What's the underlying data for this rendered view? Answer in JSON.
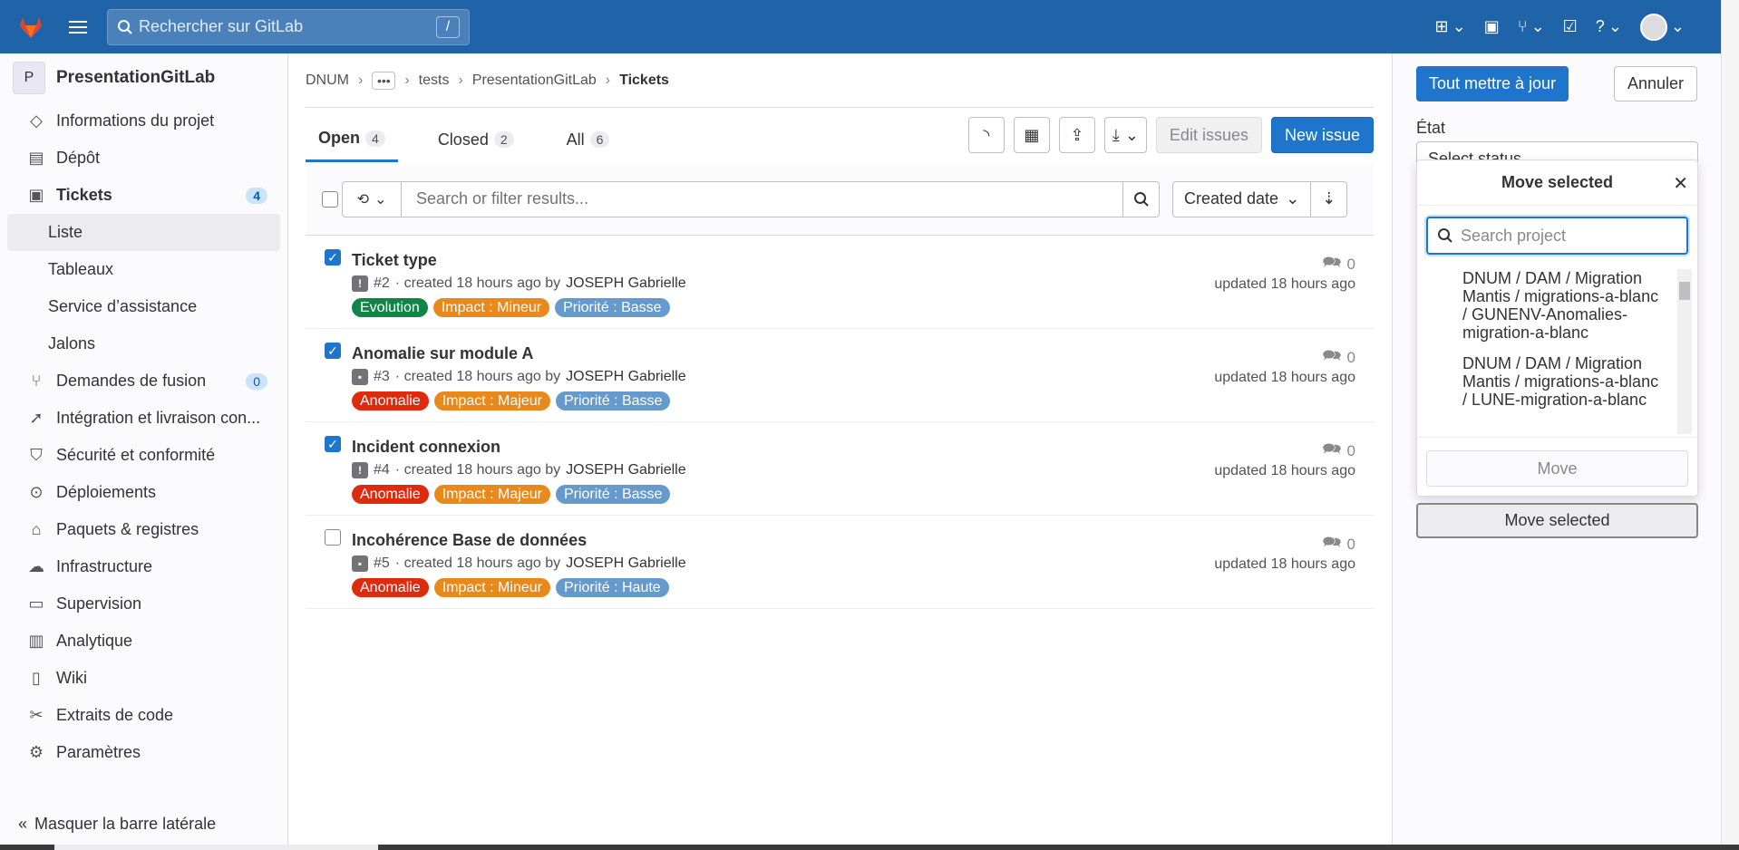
{
  "topbar": {
    "search_placeholder": "Rechercher sur GitLab",
    "search_shortcut": "/"
  },
  "sidebar": {
    "project_initial": "P",
    "project_name": "PresentationGitLab",
    "items": [
      {
        "label": "Informations du projet",
        "icon": "project-icon"
      },
      {
        "label": "Dépôt",
        "icon": "doc-icon"
      },
      {
        "label": "Tickets",
        "icon": "issues-icon",
        "count": "4"
      },
      {
        "label": "Liste"
      },
      {
        "label": "Tableaux"
      },
      {
        "label": "Service d’assistance"
      },
      {
        "label": "Jalons"
      },
      {
        "label": "Demandes de fusion",
        "icon": "merge-request-icon",
        "count": "0"
      },
      {
        "label": "Intégration et livraison con...",
        "icon": "rocket-icon"
      },
      {
        "label": "Sécurité et conformité",
        "icon": "shield-icon"
      },
      {
        "label": "Déploiements",
        "icon": "deployments-icon"
      },
      {
        "label": "Paquets & registres",
        "icon": "package-icon"
      },
      {
        "label": "Infrastructure",
        "icon": "cloud-gear-icon"
      },
      {
        "label": "Supervision",
        "icon": "monitor-icon"
      },
      {
        "label": "Analytique",
        "icon": "chart-icon"
      },
      {
        "label": "Wiki",
        "icon": "book-icon"
      },
      {
        "label": "Extraits de code",
        "icon": "snippet-icon"
      },
      {
        "label": "Paramètres",
        "icon": "settings-icon"
      }
    ],
    "collapse_label": "Masquer la barre latérale"
  },
  "breadcrumb": {
    "items": [
      "DNUM",
      "tests",
      "PresentationGitLab"
    ],
    "current": "Tickets"
  },
  "tabs": [
    {
      "label": "Open",
      "count": "4"
    },
    {
      "label": "Closed",
      "count": "2"
    },
    {
      "label": "All",
      "count": "6"
    }
  ],
  "actions": {
    "edit_issues": "Edit issues",
    "new_issue": "New issue"
  },
  "filter": {
    "placeholder": "Search or filter results...",
    "sort_label": "Created date"
  },
  "issues": [
    {
      "title": "Ticket type",
      "ref": "#2",
      "created": "· created 18 hours ago by",
      "author": "JOSEPH Gabrielle",
      "type_icon": "!",
      "checked": true,
      "comments": "0",
      "updated": "updated 18 hours ago",
      "labels": [
        {
          "text": "Evolution",
          "color": "#108548"
        },
        {
          "text": "Impact : Mineur",
          "color": "#e9891b"
        },
        {
          "text": "Priorité : Basse",
          "color": "#6699cc"
        }
      ]
    },
    {
      "title": "Anomalie sur module A",
      "ref": "#3",
      "created": "· created 18 hours ago by",
      "author": "JOSEPH Gabrielle",
      "type_icon": "▪",
      "checked": true,
      "comments": "0",
      "updated": "updated 18 hours ago",
      "labels": [
        {
          "text": "Anomalie",
          "color": "#dd2b0e"
        },
        {
          "text": "Impact : Majeur",
          "color": "#e9891b"
        },
        {
          "text": "Priorité : Basse",
          "color": "#6699cc"
        }
      ]
    },
    {
      "title": "Incident connexion",
      "ref": "#4",
      "created": "· created 18 hours ago by",
      "author": "JOSEPH Gabrielle",
      "type_icon": "!",
      "checked": true,
      "comments": "0",
      "updated": "updated 18 hours ago",
      "labels": [
        {
          "text": "Anomalie",
          "color": "#dd2b0e"
        },
        {
          "text": "Impact : Majeur",
          "color": "#e9891b"
        },
        {
          "text": "Priorité : Basse",
          "color": "#6699cc"
        }
      ]
    },
    {
      "title": "Incohérence Base de données",
      "ref": "#5",
      "created": "· created 18 hours ago by",
      "author": "JOSEPH Gabrielle",
      "type_icon": "▪",
      "checked": false,
      "comments": "0",
      "updated": "updated 18 hours ago",
      "labels": [
        {
          "text": "Anomalie",
          "color": "#dd2b0e"
        },
        {
          "text": "Impact : Mineur",
          "color": "#e9891b"
        },
        {
          "text": "Priorité : Haute",
          "color": "#6699cc"
        }
      ]
    }
  ],
  "right_panel": {
    "update_all": "Tout mettre à jour",
    "cancel": "Annuler",
    "state_label": "État",
    "state_placeholder": "Select status",
    "popover_title": "Move selected",
    "popover_search_placeholder": "Search project",
    "projects": [
      "DNUM / DAM / Migration Mantis / migrations-a-blanc / GUNENV-Anomalies-migration-a-blanc",
      "DNUM / DAM / Migration Mantis / migrations-a-blanc / LUNE-migration-a-blanc"
    ],
    "move_label": "Move",
    "move_selected_label": "Move selected"
  }
}
